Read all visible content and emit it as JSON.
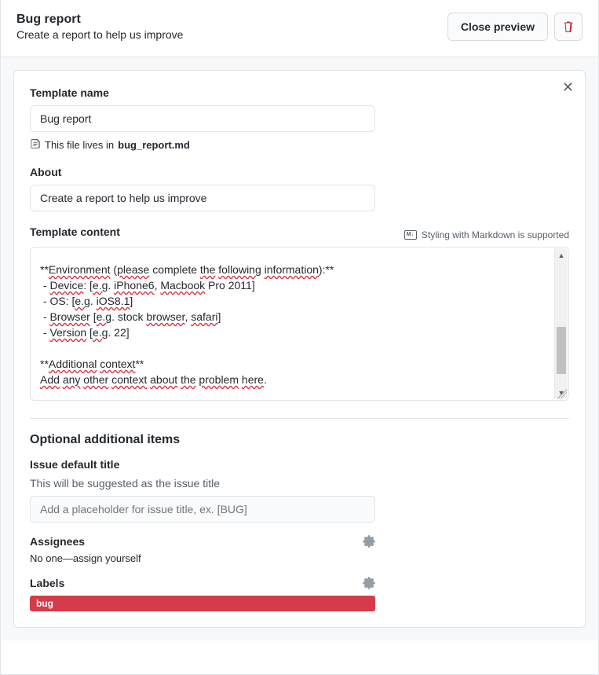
{
  "header": {
    "title": "Bug report",
    "subtitle": "Create a report to help us improve",
    "close_preview_label": "Close preview"
  },
  "template": {
    "name_label": "Template name",
    "name_value": "Bug report",
    "file_prefix": "This file lives in",
    "file_name": "bug_report.md",
    "about_label": "About",
    "about_value": "Create a report to help us improve",
    "content_label": "Template content",
    "markdown_note": "Styling with Markdown is supported",
    "content_value": "**Environment (please complete the following information):**\n - Device: [e.g. iPhone6, Macbook Pro 2011]\n - OS: [e.g. iOS8.1]\n - Browser [e.g. stock browser, safari]\n - Version [e.g. 22]\n\n**Additional context**\nAdd any other context about the problem here."
  },
  "optional": {
    "heading": "Optional additional items",
    "issue_title_label": "Issue default title",
    "issue_title_hint": "This will be suggested as the issue title",
    "issue_title_placeholder": "Add a placeholder for issue title, ex. [BUG]",
    "assignees_label": "Assignees",
    "assignees_value": "No one—assign yourself",
    "labels_label": "Labels",
    "labels_value": "bug"
  }
}
